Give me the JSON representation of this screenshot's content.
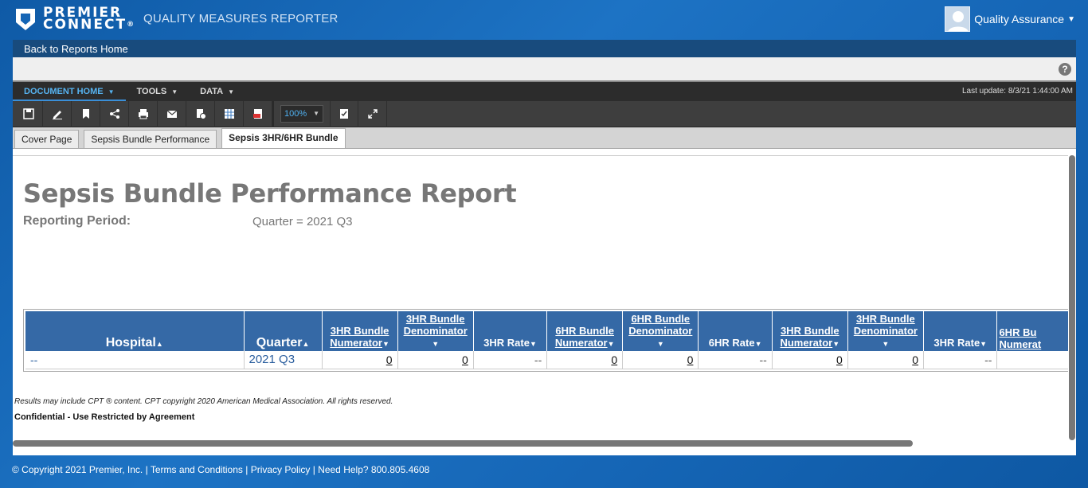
{
  "brand": {
    "line1": "PREMIER",
    "line2": "CONNECT",
    "reg": "®"
  },
  "app_title": "QUALITY MEASURES REPORTER",
  "user": {
    "name": "Quality Assurance"
  },
  "back_link": "Back to Reports Home",
  "help": "?",
  "menu": [
    {
      "label": "DOCUMENT HOME"
    },
    {
      "label": "TOOLS"
    },
    {
      "label": "DATA"
    }
  ],
  "last_update": "Last update: 8/3/21 1:44:00 AM",
  "toolbar": {
    "icons": [
      "save-icon",
      "edit-icon",
      "bookmark-icon",
      "share-icon",
      "print-icon",
      "email-icon",
      "schedule-icon",
      "excel-export-icon",
      "pdf-export-icon"
    ],
    "zoom": "100%"
  },
  "tabs": [
    {
      "label": "Cover Page"
    },
    {
      "label": "Sepsis Bundle Performance"
    },
    {
      "label": "Sepsis 3HR/6HR Bundle"
    }
  ],
  "report": {
    "title": "Sepsis Bundle Performance Report",
    "period_label": "Reporting Period:",
    "period_value": "Quarter = 2021 Q3"
  },
  "table": {
    "headers": [
      {
        "line1": "",
        "line2": "Hospital"
      },
      {
        "line1": "",
        "line2": "Quarter"
      },
      {
        "line1": "3HR Bundle",
        "line2": "Numerator"
      },
      {
        "line1": "3HR Bundle",
        "line2": "Denominator"
      },
      {
        "line1": "",
        "line2": "3HR Rate"
      },
      {
        "line1": "6HR Bundle",
        "line2": "Numerator"
      },
      {
        "line1": "6HR Bundle",
        "line2": "Denominator"
      },
      {
        "line1": "",
        "line2": "6HR Rate"
      },
      {
        "line1": "3HR Bundle",
        "line2": "Numerator"
      },
      {
        "line1": "3HR Bundle",
        "line2": "Denominator"
      },
      {
        "line1": "",
        "line2": "3HR Rate"
      },
      {
        "line1": "6HR Bu",
        "line2": "Numerat"
      }
    ],
    "row": [
      "--",
      "2021 Q3",
      "0",
      "0",
      "--",
      "0",
      "0",
      "--",
      "0",
      "0",
      "--",
      ""
    ]
  },
  "footnote": "Results may include CPT ® content. CPT copyright  2020 American Medical Association.  All rights reserved.",
  "confidential": "Confidential - Use Restricted by Agreement",
  "footer": {
    "copyright": "© Copyright 2021 Premier, Inc.",
    "terms": "Terms and Conditions",
    "privacy": "Privacy Policy",
    "help": "Need Help? 800.805.4608"
  }
}
